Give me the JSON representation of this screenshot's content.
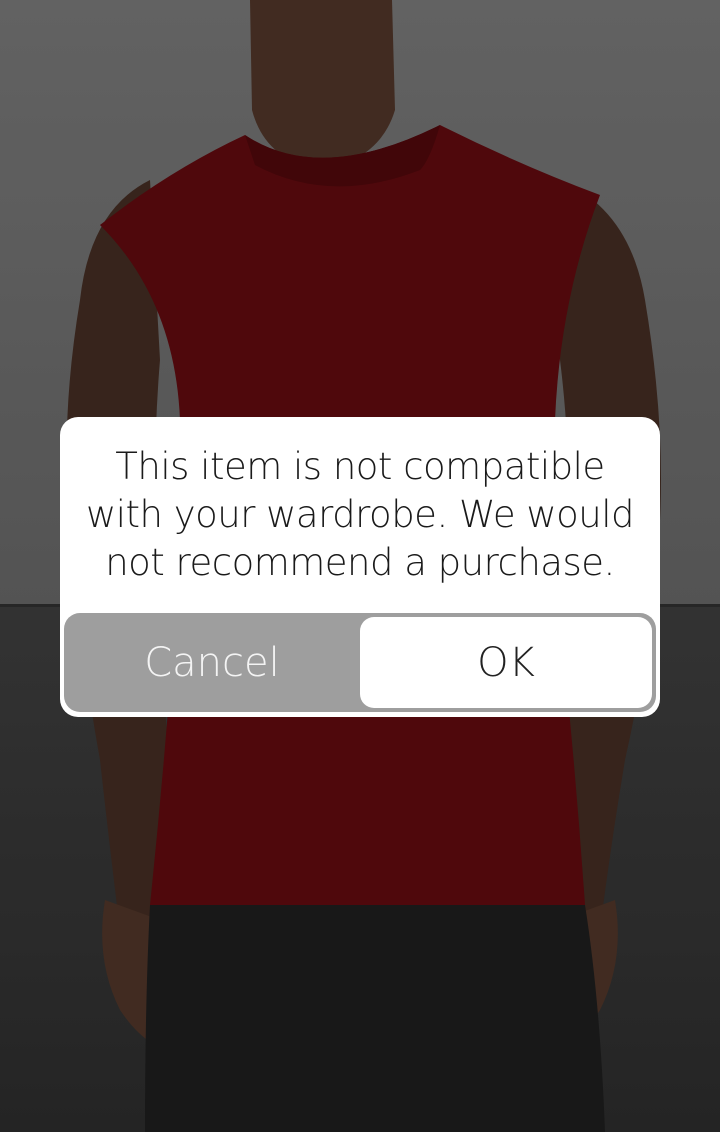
{
  "dialog": {
    "message": "This item is not compatible with your wardrobe. We would not recommend a purchase.",
    "cancel_label": "Cancel",
    "ok_label": "OK"
  },
  "background": {
    "product_photo": "model-wearing-red-sleeveless-shirt"
  },
  "colors": {
    "shirt": "#5a0a0e",
    "skin": "#4a3226",
    "pants": "#1c1c1c",
    "dialog_bg": "#ffffff",
    "button_row_bg": "#9e9e9e"
  }
}
